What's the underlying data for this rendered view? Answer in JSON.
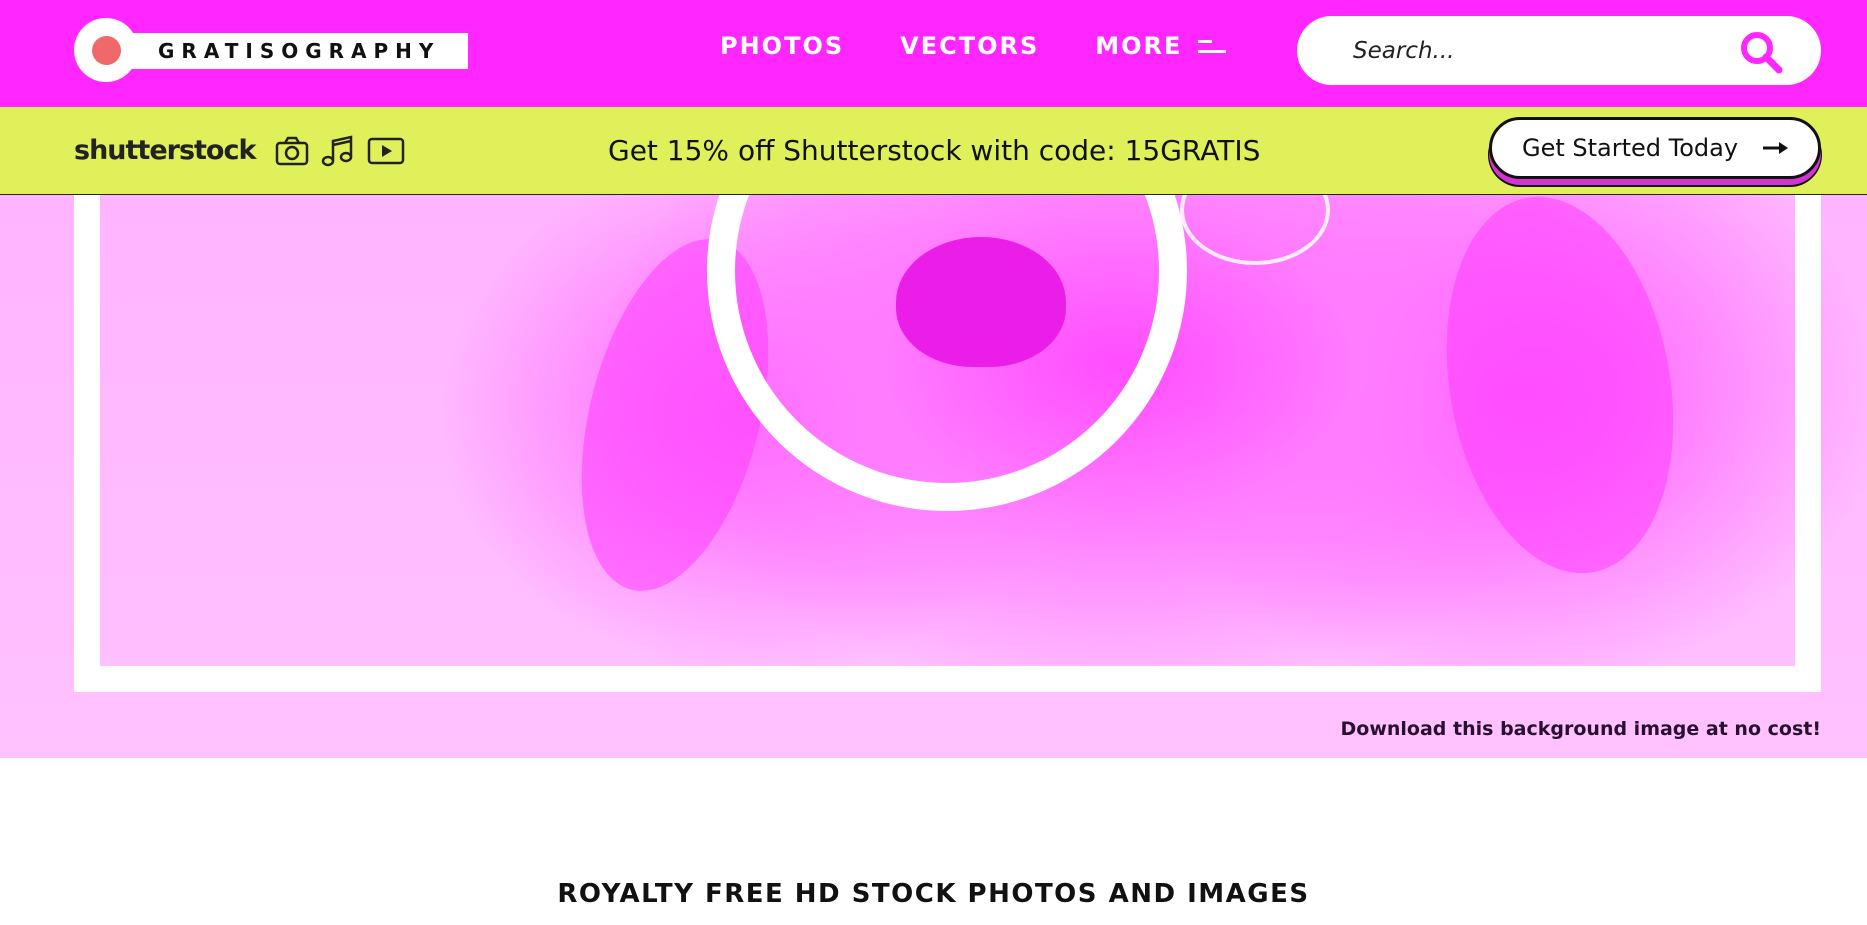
{
  "brand": {
    "logo_text": "GRATISOGRAPHY",
    "logo_dot_color": "#f0696a",
    "accent_color": "#ff26ff"
  },
  "nav": {
    "photos": "PHOTOS",
    "vectors": "VECTORS",
    "more": "MORE",
    "more_icon": "menu-lines-icon"
  },
  "search": {
    "placeholder": "Search...",
    "icon": "magnifier-icon"
  },
  "promo": {
    "partner_logo": "shutterstock",
    "icons": [
      "camera-icon",
      "music-note-icon",
      "video-play-icon"
    ],
    "message": "Get 15% off Shutterstock with code: 15GRATIS",
    "cta_label": "Get Started Today",
    "cta_icon": "arrow-right-icon",
    "bar_color": "#dff05a"
  },
  "hero": {
    "caption": "Download this background image at no cost!"
  },
  "section": {
    "title": "ROYALTY FREE HD STOCK PHOTOS AND IMAGES"
  }
}
